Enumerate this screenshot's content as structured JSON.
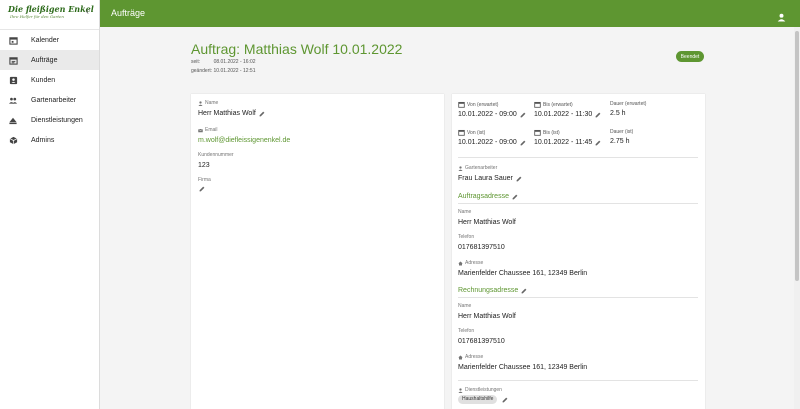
{
  "sidebar": {
    "brand_title": "Die fleißigen Enkel",
    "brand_subtitle": "Ihre Helfer für den Garten",
    "items": [
      {
        "label": "Kalender",
        "icon": "calendar-icon"
      },
      {
        "label": "Aufträge",
        "icon": "orders-icon",
        "active": true
      },
      {
        "label": "Kunden",
        "icon": "contacts-icon"
      },
      {
        "label": "Gartenarbeiter",
        "icon": "people-icon"
      },
      {
        "label": "Dienstleistungen",
        "icon": "services-icon"
      },
      {
        "label": "Admins",
        "icon": "admin-icon"
      }
    ]
  },
  "topbar": {
    "title": "Aufträge"
  },
  "order": {
    "title": "Auftrag: Matthias Wolf 10.01.2022",
    "since_label": "seit:",
    "since_value": "08.01.2022 - 16:02",
    "changed": "geändert: 10.01.2022 - 12:51",
    "status": "Beendet"
  },
  "customer": {
    "name_label": "Name",
    "name": "Herr Matthias Wolf",
    "email_label": "Email",
    "email": "m.wolf@diefleissigenenkel.de",
    "customer_number_label": "Kundennummer",
    "customer_number": "123",
    "company_label": "Firma"
  },
  "times": {
    "from_expected_label": "Von (erwartet)",
    "from_expected": "10.01.2022 - 09:00",
    "to_expected_label": "Bis (erwartet)",
    "to_expected": "10.01.2022 - 11:30",
    "duration_expected_label": "Dauer (erwartet)",
    "duration_expected": "2.5 h",
    "from_actual_label": "Von (ist)",
    "from_actual": "10.01.2022 - 09:00",
    "to_actual_label": "Bis (ist)",
    "to_actual": "10.01.2022 - 11:45",
    "duration_actual_label": "Dauer (ist)",
    "duration_actual": "2.75 h"
  },
  "gardener": {
    "label": "Gartenarbeiter",
    "value": "Frau Laura Sauer"
  },
  "order_address": {
    "title": "Auftragsadresse",
    "name_label": "Name",
    "name": "Herr Matthias Wolf",
    "phone_label": "Telefon",
    "phone": "017681397510",
    "address_label": "Adresse",
    "address": "Marienfelder Chaussee 161, 12349 Berlin"
  },
  "billing_address": {
    "title": "Rechnungsadresse",
    "name_label": "Name",
    "name": "Herr Matthias Wolf",
    "phone_label": "Telefon",
    "phone": "017681397510",
    "address_label": "Adresse",
    "address": "Marienfelder Chaussee 161, 12349 Berlin"
  },
  "services": {
    "label": "Dienstleistungen",
    "items": [
      "Haushaltshilfe"
    ]
  },
  "colors": {
    "brand": "#5e9631",
    "badge": "#5e9631"
  }
}
